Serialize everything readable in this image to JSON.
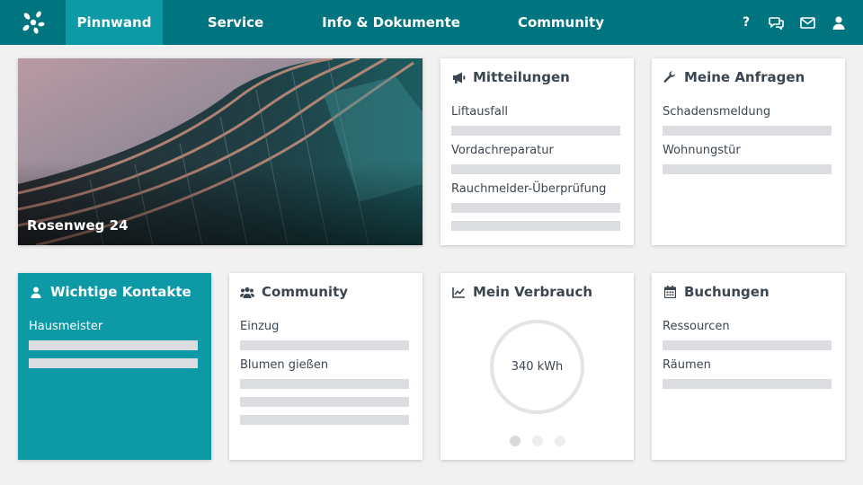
{
  "nav": {
    "logo_icon": "brand-logo",
    "items": [
      {
        "label": "Pinnwand",
        "active": true
      },
      {
        "label": "Service"
      },
      {
        "label": "Info & Dokumente"
      },
      {
        "label": "Community"
      }
    ],
    "icons": [
      "help-icon",
      "chat-icon",
      "mail-icon",
      "user-icon"
    ],
    "help_label": "?"
  },
  "colors": {
    "topbar": "#00757f",
    "accent": "#0e99a6",
    "background": "#f1f1f2",
    "placeholder_bar": "#dcdde0"
  },
  "hero": {
    "label": "Rosenweg 24"
  },
  "mitteilungen": {
    "title": "Mitteilungen",
    "icon": "megaphone-icon",
    "items": [
      "Liftausfall",
      "Vordachreparatur",
      "Rauchmelder-Überprüfung"
    ]
  },
  "anfragen": {
    "title": "Meine Anfragen",
    "icon": "wrench-icon",
    "items": [
      "Schadensmeldung",
      "Wohnungstür"
    ]
  },
  "kontakte": {
    "title": "Wichtige Kontakte",
    "icon": "person-icon",
    "items": [
      "Hausmeister"
    ]
  },
  "community": {
    "title": "Community",
    "icon": "group-icon",
    "items": [
      "Einzug",
      "Blumen gießen"
    ]
  },
  "verbrauch": {
    "title": "Mein Verbrauch",
    "icon": "line-chart-icon",
    "value": "340 kWh",
    "carousel": {
      "count": 3,
      "active_index": 0
    }
  },
  "buchungen": {
    "title": "Buchungen",
    "icon": "calendar-icon",
    "items": [
      "Ressourcen",
      "Räumen"
    ]
  }
}
